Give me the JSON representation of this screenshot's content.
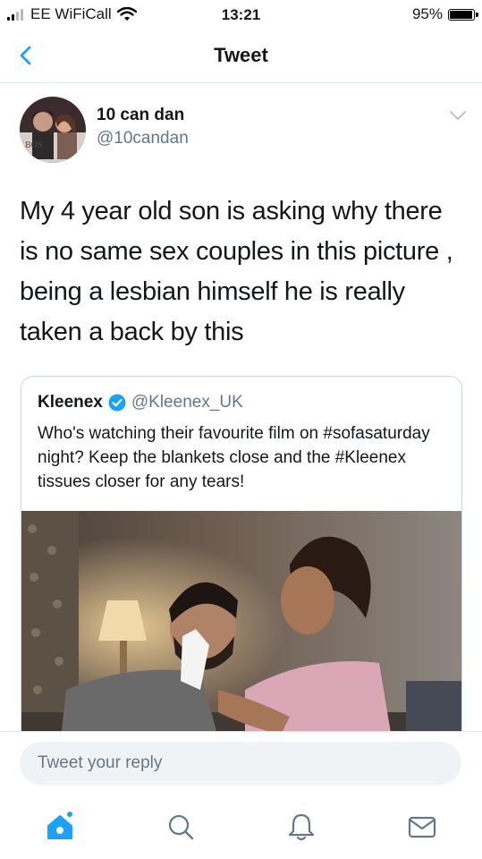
{
  "status_bar": {
    "carrier": "EE WiFiCall",
    "time": "13:21",
    "battery": "95%",
    "battery_level": 0.95
  },
  "nav": {
    "title": "Tweet",
    "back_icon": "chevron-left-icon"
  },
  "tweet": {
    "author_name": "10 can dan",
    "author_handle": "@10candan",
    "avatar_text": "BOS",
    "text": "My 4 year old son is asking why there is no same sex couples in this picture , being a lesbian himself he is really taken a back by this"
  },
  "quoted_tweet": {
    "author_name": "Kleenex",
    "author_handle": "@Kleenex_UK",
    "verified_icon": "verified-badge-icon",
    "text": "Who's watching their favourite film on #sofasaturday night? Keep the blankets close and the #Kleenex tissues closer for any tears!"
  },
  "reply": {
    "placeholder": "Tweet your reply"
  },
  "tab_bar": {
    "items": [
      {
        "icon": "home-icon",
        "active": true
      },
      {
        "icon": "search-icon",
        "active": false
      },
      {
        "icon": "notifications-bell-icon",
        "active": false
      },
      {
        "icon": "messages-envelope-icon",
        "active": false
      }
    ]
  },
  "colors": {
    "accent": "#1da1f2",
    "secondary_text": "#657786",
    "border": "#e1e8ed"
  }
}
